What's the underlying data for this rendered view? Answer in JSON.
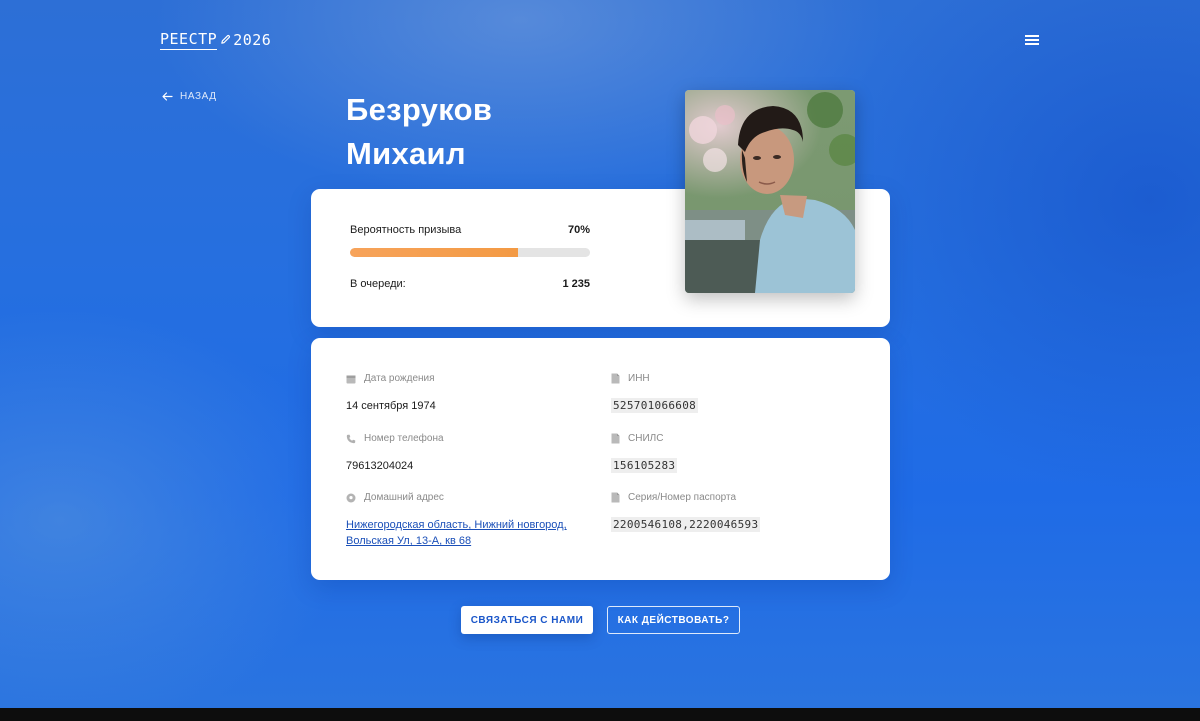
{
  "header": {
    "logo_part1": "РЕЕСТР",
    "logo_part2": "2026",
    "menu_icon": "hamburger-menu-icon"
  },
  "nav": {
    "back_label": "НАЗАД",
    "back_icon": "arrow-left-icon"
  },
  "person": {
    "last_name": "Безруков",
    "first_name": "Михаил",
    "photo": "portrait-photo"
  },
  "summary": {
    "probability_label": "Вероятность призыва",
    "probability_value": "70%",
    "probability_fraction": 0.7,
    "queue_label": "В очереди:",
    "queue_value": "1 235"
  },
  "details": {
    "birth_date": {
      "label": "Дата рождения",
      "value": "14 сентября 1974",
      "icon": "calendar-icon"
    },
    "phone": {
      "label": "Номер телефона",
      "value": "79613204024",
      "icon": "phone-icon"
    },
    "address": {
      "label": "Домашний адрес",
      "line1": "Нижегородская область, Нижний новгород,",
      "line2": "Вольская Ул, 13-А, кв 68",
      "icon": "location-pin-icon"
    },
    "inn": {
      "label": "ИНН",
      "value": "525701066608",
      "icon": "document-icon"
    },
    "snils": {
      "label": "СНИЛС",
      "value": "156105283",
      "icon": "document-icon"
    },
    "passport": {
      "label": "Серия/Номер паспорта",
      "value": "2200546108,2220046593",
      "icon": "document-icon"
    }
  },
  "actions": {
    "contact_label": "СВЯЗАТЬСЯ С НАМИ",
    "howto_label": "КАК ДЕЙСТВОВАТЬ?"
  },
  "colors": {
    "background": "#2570e0",
    "progress": "#f5a04e",
    "link": "#1a4fb8"
  }
}
